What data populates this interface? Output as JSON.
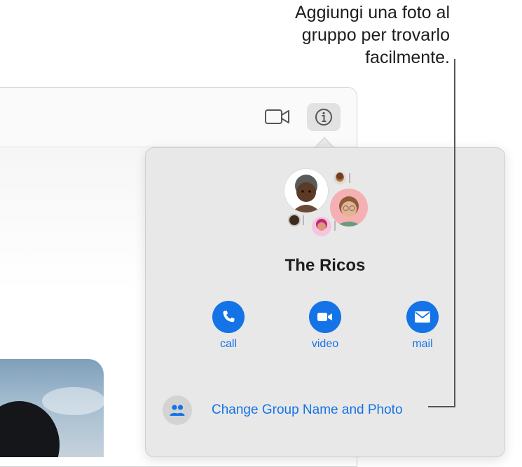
{
  "callout": {
    "lines": [
      "Aggiungi una foto al",
      "gruppo per trovarlo",
      "facilmente."
    ]
  },
  "toolbar": {
    "video_icon": "video-camera-icon",
    "info_icon": "info-icon"
  },
  "popover": {
    "group_name": "The Ricos",
    "actions": [
      {
        "label": "call",
        "icon": "phone-icon"
      },
      {
        "label": "video",
        "icon": "video-camera-icon"
      },
      {
        "label": "mail",
        "icon": "envelope-icon"
      }
    ],
    "change_link": "Change Group Name and Photo",
    "change_icon": "people-icon"
  },
  "colors": {
    "accent": "#1473e6",
    "popover_bg": "#e8e8e8"
  }
}
